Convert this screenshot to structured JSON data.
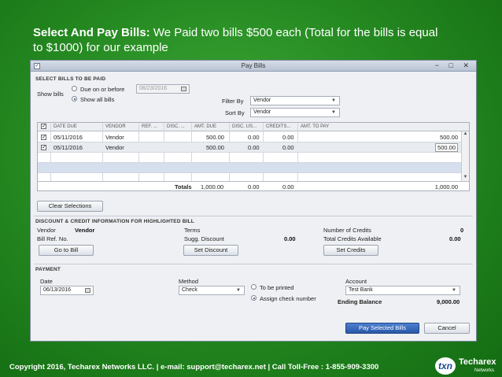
{
  "slide": {
    "title_bold": "Select And Pay Bills:",
    "title_rest": " We Paid two bills $500 each (Total for the bills is equal to $1000) for our example",
    "footer": "Copyright 2016, Techarex Networks LLC. | e-mail: support@techarex.net | Call Toll-Free : 1-855-909-3300",
    "logo_mark": "txn",
    "logo_name": "Techarex",
    "logo_sub": "Networks"
  },
  "window": {
    "title": "Pay Bills",
    "controls": "− □ ✕"
  },
  "select_section": {
    "heading": "SELECT BILLS TO BE PAID",
    "show_bills_label": "Show bills",
    "radio_due_label": "Due on or before",
    "radio_due_date": "06/23/2016",
    "radio_all_label": "Show all bills",
    "filter_by_label": "Filter By",
    "filter_by_value": "Vendor",
    "sort_by_label": "Sort By",
    "sort_by_value": "Vendor"
  },
  "table": {
    "headers": {
      "date_due": "DATE DUE",
      "vendor": "VENDOR",
      "ref": "REF. ...",
      "disc_date": "DISC. ...",
      "amt_due": "AMT. DUE",
      "disc_used": "DISC. US...",
      "credits": "CREDITS...",
      "amt_to_pay": "AMT. TO PAY"
    },
    "rows": [
      {
        "date_due": "05/11/2016",
        "vendor": "Vendor",
        "amt_due": "500.00",
        "disc_used": "0.00",
        "credits": "0.00",
        "amt_to_pay": "500.00"
      },
      {
        "date_due": "05/11/2016",
        "vendor": "Vendor",
        "amt_due": "500.00",
        "disc_used": "0.00",
        "credits": "0.00",
        "amt_to_pay": "500.00"
      }
    ],
    "totals": {
      "label": "Totals",
      "amt_due": "1,000.00",
      "disc_used": "0.00",
      "credits": "0.00",
      "amt_to_pay": "1,000.00"
    }
  },
  "clear_selections_label": "Clear Selections",
  "discount_section": {
    "heading": "DISCOUNT & CREDIT INFORMATION FOR HIGHLIGHTED BILL",
    "vendor_label": "Vendor",
    "vendor_value": "Vendor",
    "bill_ref_label": "Bill Ref. No.",
    "terms_label": "Terms",
    "sugg_discount_label": "Sugg. Discount",
    "sugg_discount_value": "0.00",
    "num_credits_label": "Number of Credits",
    "num_credits_value": "0",
    "total_credits_label": "Total Credits Available",
    "total_credits_value": "0.00",
    "go_to_bill": "Go to Bill",
    "set_discount": "Set Discount",
    "set_credits": "Set Credits"
  },
  "payment_section": {
    "heading": "PAYMENT",
    "date_label": "Date",
    "date_value": "06/13/2016",
    "method_label": "Method",
    "method_value": "Check",
    "to_be_printed": "To be printed",
    "assign_check_number": "Assign check number",
    "account_label": "Account",
    "account_value": "Test Bank",
    "ending_balance_label": "Ending Balance",
    "ending_balance_value": "9,000.00"
  },
  "actions": {
    "pay_selected": "Pay Selected Bills",
    "cancel": "Cancel"
  }
}
